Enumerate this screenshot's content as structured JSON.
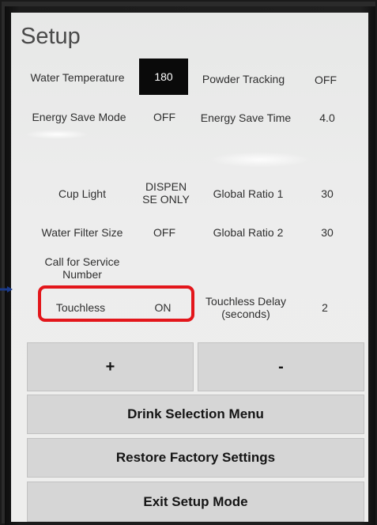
{
  "title": "Setup",
  "settings": {
    "water_temperature": {
      "label": "Water Temperature",
      "value": "180"
    },
    "powder_tracking": {
      "label": "Powder Tracking",
      "value": "OFF"
    },
    "energy_save_mode": {
      "label": "Energy Save Mode",
      "value": "OFF"
    },
    "energy_save_time": {
      "label": "Energy Save Time",
      "value": "4.0"
    },
    "cup_light": {
      "label": "Cup Light",
      "value_line1": "DISPEN",
      "value_line2": "SE ONLY"
    },
    "global_ratio_1": {
      "label": "Global Ratio 1",
      "value": "30"
    },
    "water_filter_size": {
      "label": "Water Filter Size",
      "value": "OFF"
    },
    "global_ratio_2": {
      "label": "Global Ratio 2",
      "value": "30"
    },
    "call_for_service": {
      "label_line1": "Call for Service",
      "label_line2": "Number"
    },
    "touchless": {
      "label": "Touchless",
      "value": "ON"
    },
    "touchless_delay": {
      "label_line1": "Touchless Delay",
      "label_line2": "(seconds)",
      "value": "2"
    }
  },
  "buttons": {
    "plus": "+",
    "minus": "-",
    "drink_selection": "Drink Selection Menu",
    "restore_factory": "Restore Factory Settings",
    "exit_setup": "Exit Setup Mode"
  },
  "colors": {
    "highlight": "#e3161b",
    "selected_value_bg": "#0a0a0a",
    "button_bg": "#d6d6d6"
  }
}
